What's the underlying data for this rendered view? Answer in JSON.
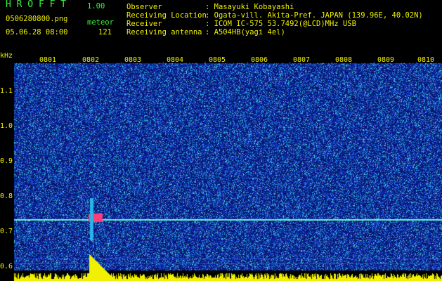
{
  "header": {
    "app_letters": "H R O F F T",
    "version": "1.00",
    "filename": "0506280800.png",
    "meteor_label": "meteor",
    "datetime": "05.06.28 08:00",
    "meteor_count": "121",
    "fields": [
      {
        "label": "Observer",
        "value": ": Masayuki Kobayashi"
      },
      {
        "label": "Receiving Location",
        "value": ": Ogata-vill. Akita-Pref. JAPAN (139.96E, 40.02N)"
      },
      {
        "label": "Receiver",
        "value": ": ICOM IC-575 53.7492(@LCD)MHz USB"
      },
      {
        "label": "Receiving antenna",
        "value": ": A504HB(yagi 4el)"
      }
    ]
  },
  "axes": {
    "y_unit": "kHz",
    "y_ticks": [
      "1.1",
      "1.0",
      "0.9",
      "0.8",
      "0.7",
      "0.6"
    ],
    "x_ticks": [
      "0801",
      "0802",
      "0803",
      "0804",
      "0805",
      "0806",
      "0807",
      "0808",
      "0809",
      "0810"
    ]
  },
  "colors": {
    "background": "#000000",
    "noise_dark": "#0a1470",
    "noise_mid": "#1e46d2",
    "noise_bright": "#28b4e6",
    "carrier": "#6ef0d2",
    "meteor_head": "#ff3c78",
    "level_bars": "#f0f000",
    "text_green": "#3cf03c",
    "text_yellow": "#f0f000"
  }
}
